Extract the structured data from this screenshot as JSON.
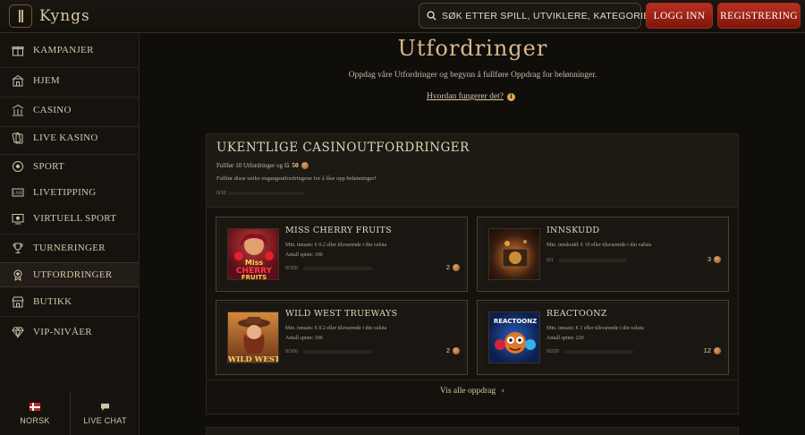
{
  "header": {
    "logo": "Kyngs",
    "search_placeholder": "SØK ETTER SPILL, UTVIKLERE, KATEGORIER",
    "login_label": "LOGG INN",
    "register_label": "REGISTRERING"
  },
  "sidebar": {
    "items": [
      {
        "label": "KAMPANJER",
        "icon": "gift-icon"
      },
      {
        "label": "HJEM",
        "icon": "home-icon"
      },
      {
        "label": "CASINO",
        "icon": "casino-building-icon"
      },
      {
        "label": "LIVE KASINO",
        "icon": "cards-icon"
      },
      {
        "label": "SPORT",
        "icon": "football-icon"
      },
      {
        "label": "LIVETIPPING",
        "icon": "live-tv-icon"
      },
      {
        "label": "VIRTUELL SPORT",
        "icon": "virtual-screen-icon"
      },
      {
        "label": "TURNERINGER",
        "icon": "trophy-icon"
      },
      {
        "label": "UTFORDRINGER",
        "icon": "medal-icon",
        "active": true
      },
      {
        "label": "BUTIKK",
        "icon": "shop-icon"
      },
      {
        "label": "VIP-NIVÅER",
        "icon": "diamond-icon"
      }
    ],
    "language": "NORSK",
    "live_chat": "LIVE CHAT"
  },
  "main": {
    "title": "Utfordringer",
    "intro": "Oppdag våre Utfordringer og begynn å fullføre Oppdrag for belønninger.",
    "how_link": "Hvordan fungerer det?",
    "panel": {
      "title": "UKENTLIGE CASINOUTFORDRINGER",
      "subtitle_prefix": "Fullfør 10 Utfordringer og få",
      "subtitle_amount": "50",
      "description": "Fullfør disse unike engangsutfordringene for å låse opp belønninger!",
      "progress_label": "0/10",
      "progress_fraction": 0,
      "see_all": "Vis alle oppdrag"
    },
    "cards": [
      {
        "title": "MISS CHERRY FRUITS",
        "line1": "Min. innsats: € 0.2 eller tilsvarende i din valuta",
        "line2": "Antall spinn: 100",
        "progress_label": "0/100",
        "progress_fraction": 0,
        "reward": "2"
      },
      {
        "title": "INNSKUDD",
        "line1": "Min. innskudd: € 10 eller tilsvarende i din valuta",
        "line2": "",
        "progress_label": "0/1",
        "progress_fraction": 0,
        "reward": "3"
      },
      {
        "title": "WILD WEST TRUEWAYS",
        "line1": "Min. innsats: € 0.2 eller tilsvarende i din valuta",
        "line2": "Antall spinn: 100",
        "progress_label": "0/100",
        "progress_fraction": 0,
        "reward": "2"
      },
      {
        "title": "REACTOONZ",
        "line1": "Min. innsats: € 1 eller tilsvarende i din valuta",
        "line2": "Antall spinn: 220",
        "progress_label": "0/220",
        "progress_fraction": 0,
        "reward": "12"
      }
    ],
    "thumb_texts": {
      "cherry": "MISS CHERRY FRUITS",
      "wildwest": "WILD WEST",
      "reactoonz": "REACTOONZ"
    }
  },
  "colors": {
    "accent_red": "#b8301f",
    "gold_title": "#d9b98a",
    "background": "#100e0b"
  }
}
